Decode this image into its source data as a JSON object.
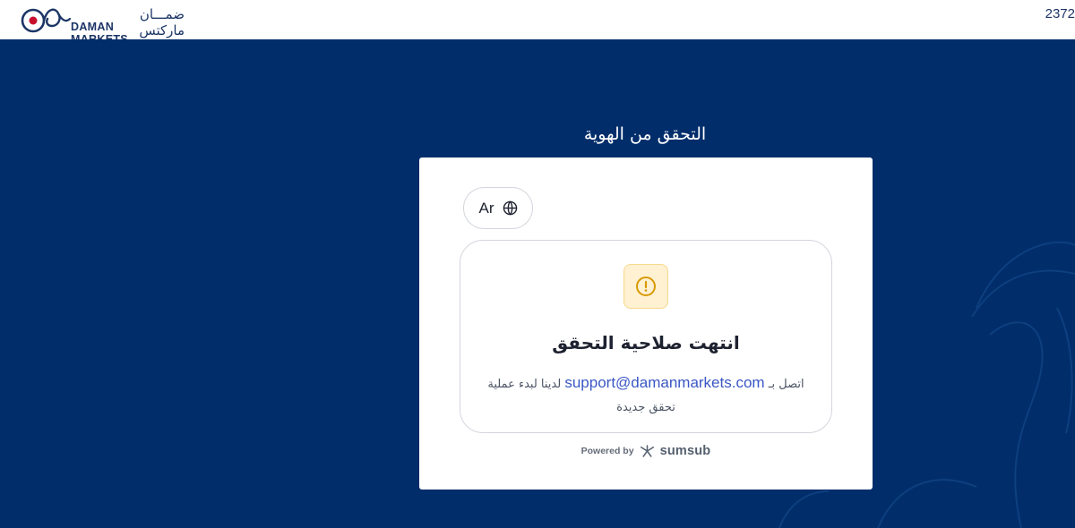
{
  "header": {
    "logo_ar": "ضمـــان ماركتس",
    "logo_en": "DAMAN MARKETS",
    "top_right_number": "2372"
  },
  "main": {
    "page_title": "التحقق من الهوية"
  },
  "card": {
    "language_button": {
      "label": "Ar",
      "icon": "globe-icon"
    },
    "status": {
      "icon": "warning-icon",
      "title": "انتهت صلاحية التحقق",
      "message_before": "اتصل بـ",
      "email": "support@damanmarkets.com",
      "message_after": "لدينا لبدء عملية تحقق جديدة"
    },
    "footer": {
      "powered_label": "Powered by",
      "brand": "sumsub",
      "brand_icon": "sumsub-logo-icon"
    }
  },
  "colors": {
    "background": "#012d6b",
    "card": "#ffffff",
    "link": "#3a57c4",
    "warning_tile": "#fff1d1",
    "warning_icon": "#d99a07"
  }
}
